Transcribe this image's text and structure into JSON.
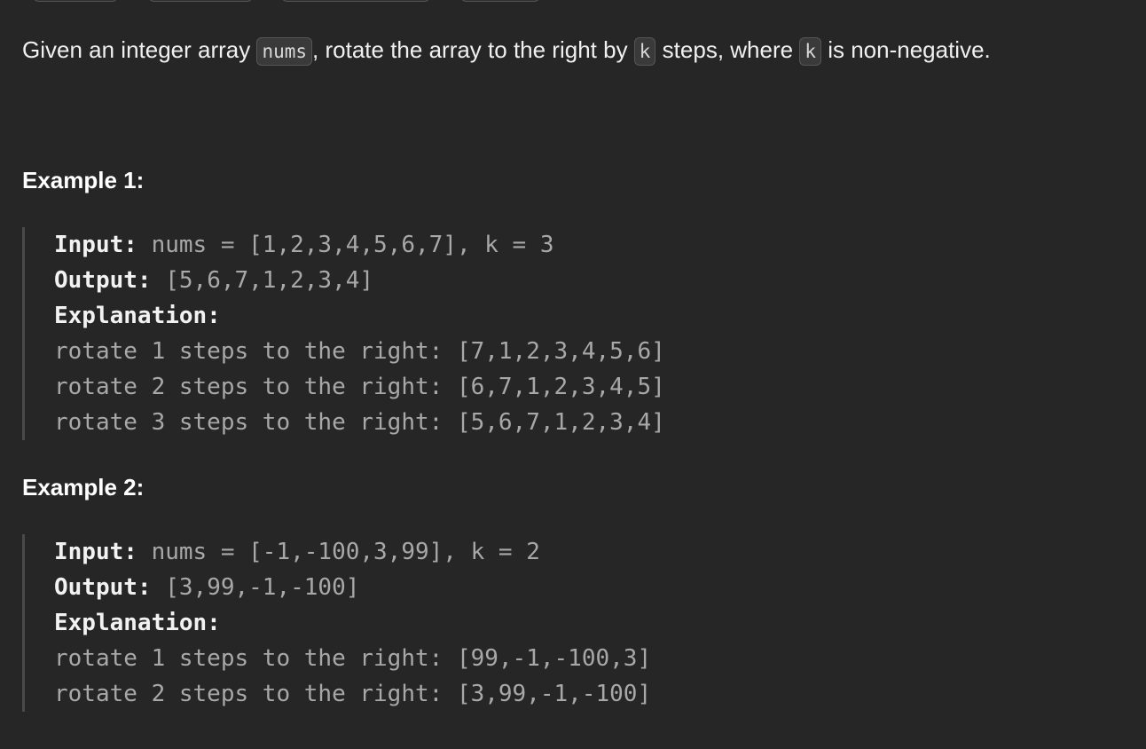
{
  "description": {
    "before_nums": "Given an integer array ",
    "nums_code": "nums",
    "between_nums_k": ", rotate the array to the right by ",
    "k_code_1": "k",
    "between_k": " steps, where ",
    "k_code_2": "k",
    "after_k": " is non-negative."
  },
  "examples": [
    {
      "title": "Example 1:",
      "input_label": "Input:",
      "input_value": " nums = [1,2,3,4,5,6,7], k = 3",
      "output_label": "Output:",
      "output_value": " [5,6,7,1,2,3,4]",
      "explanation_label": "Explanation:",
      "explanation_lines": [
        "rotate 1 steps to the right: [7,1,2,3,4,5,6]",
        "rotate 2 steps to the right: [6,7,1,2,3,4,5]",
        "rotate 3 steps to the right: [5,6,7,1,2,3,4]"
      ]
    },
    {
      "title": "Example 2:",
      "input_label": "Input:",
      "input_value": " nums = [-1,-100,3,99], k = 2",
      "output_label": "Output:",
      "output_value": " [3,99,-1,-100]",
      "explanation_label": "Explanation:",
      "explanation_lines": [
        "rotate 1 steps to the right: [99,-1,-100,3]",
        "rotate 2 steps to the right: [3,99,-1,-100]"
      ]
    }
  ]
}
